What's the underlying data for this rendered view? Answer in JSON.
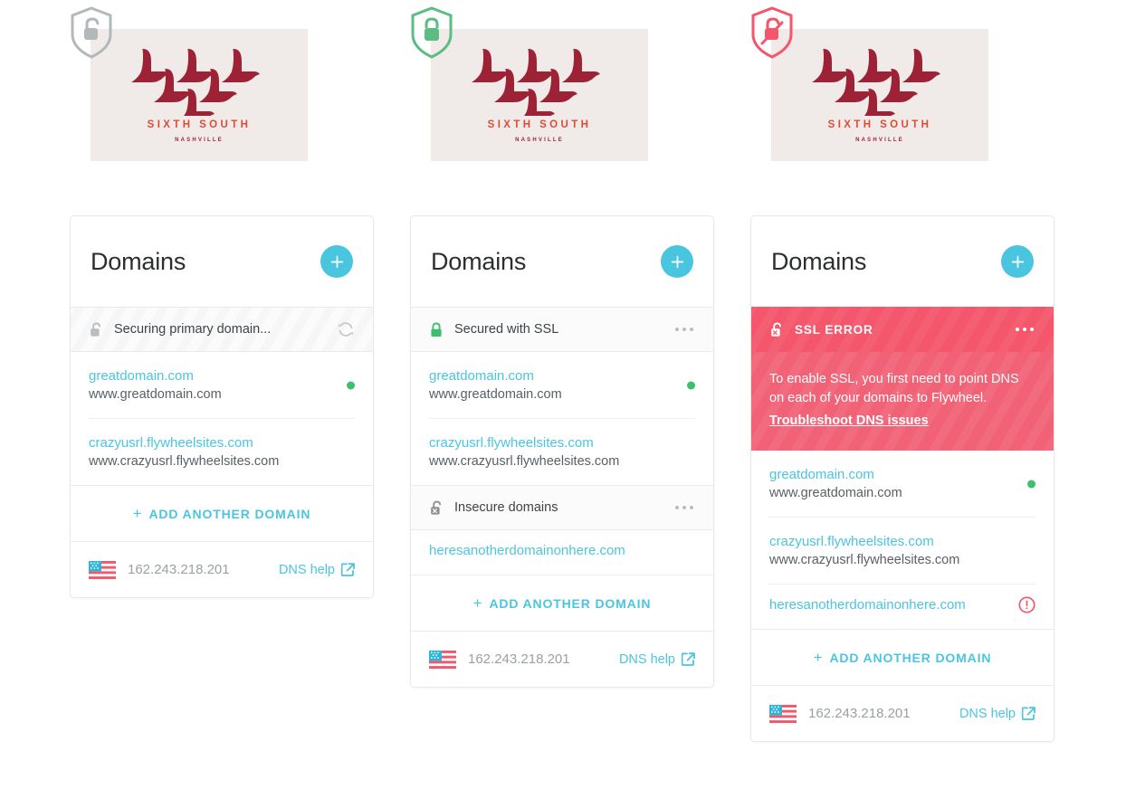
{
  "logo": {
    "name": "SIXTH SOUTH",
    "subtitle": "NASHVILLE",
    "bird_color": "#9d2235",
    "name_color": "#e04a35",
    "background": "#f0ebe8"
  },
  "colors": {
    "accent": "#4ac5e0",
    "success": "#3fbf6d",
    "error": "#f4566b",
    "error_body": "#f16276",
    "muted": "#9aa0a4",
    "shield_gray": "#b3b8bb"
  },
  "cards": [
    {
      "id": "securing",
      "shield_icon": "shield-unlocked-icon",
      "shield_color": "#b3b8bb",
      "title": "Domains",
      "add_button_label": "+",
      "status": {
        "icon": "unlocked-padlock-icon",
        "label": "Securing primary domain...",
        "action_icon": "refresh-spinner-icon",
        "style": "striped"
      },
      "domains": [
        {
          "primary": "greatdomain.com",
          "secondary": "www.greatdomain.com",
          "status": "ok"
        },
        {
          "primary": "crazyusrl.flywheelsites.com",
          "secondary": "www.crazyusrl.flywheelsites.com",
          "status": "none"
        }
      ],
      "add_another_label": "ADD ANOTHER DOMAIN",
      "footer": {
        "flag_icon": "us-flag-icon",
        "ip": "162.243.218.201",
        "help_label": "DNS help",
        "help_icon": "external-link-icon"
      }
    },
    {
      "id": "secured",
      "shield_icon": "shield-locked-icon",
      "shield_color": "#5bbd82",
      "title": "Domains",
      "add_button_label": "+",
      "status": {
        "icon": "locked-padlock-icon",
        "label": "Secured with SSL",
        "action_icon": "more-dots-icon",
        "style": "plain"
      },
      "domains": [
        {
          "primary": "greatdomain.com",
          "secondary": "www.greatdomain.com",
          "status": "ok"
        },
        {
          "primary": "crazyusrl.flywheelsites.com",
          "secondary": "www.crazyusrl.flywheelsites.com",
          "status": "none"
        }
      ],
      "insecure": {
        "icon": "unlocked-padlock-x-icon",
        "label": "Insecure domains",
        "action_icon": "more-dots-icon",
        "domains": [
          {
            "primary": "heresanotherdomainonhere.com",
            "secondary": "",
            "status": "none"
          }
        ]
      },
      "add_another_label": "ADD ANOTHER DOMAIN",
      "footer": {
        "flag_icon": "us-flag-icon",
        "ip": "162.243.218.201",
        "help_label": "DNS help",
        "help_icon": "external-link-icon"
      }
    },
    {
      "id": "error",
      "shield_icon": "shield-padlock-slash-icon",
      "shield_color": "#f4566b",
      "title": "Domains",
      "add_button_label": "+",
      "error": {
        "icon": "unlocked-padlock-x-icon",
        "heading": "SSL ERROR",
        "action_icon": "more-dots-icon",
        "message": "To enable SSL, you first need to point DNS on each of your domains to Flywheel.",
        "link_label": "Troubleshoot DNS issues"
      },
      "domains": [
        {
          "primary": "greatdomain.com",
          "secondary": "www.greatdomain.com",
          "status": "ok"
        },
        {
          "primary": "crazyusrl.flywheelsites.com",
          "secondary": "www.crazyusrl.flywheelsites.com",
          "status": "none"
        },
        {
          "primary": "heresanotherdomainonhere.com",
          "secondary": "",
          "status": "error"
        }
      ],
      "add_another_label": "ADD ANOTHER DOMAIN",
      "footer": {
        "flag_icon": "us-flag-icon",
        "ip": "162.243.218.201",
        "help_label": "DNS help",
        "help_icon": "external-link-icon"
      }
    }
  ]
}
